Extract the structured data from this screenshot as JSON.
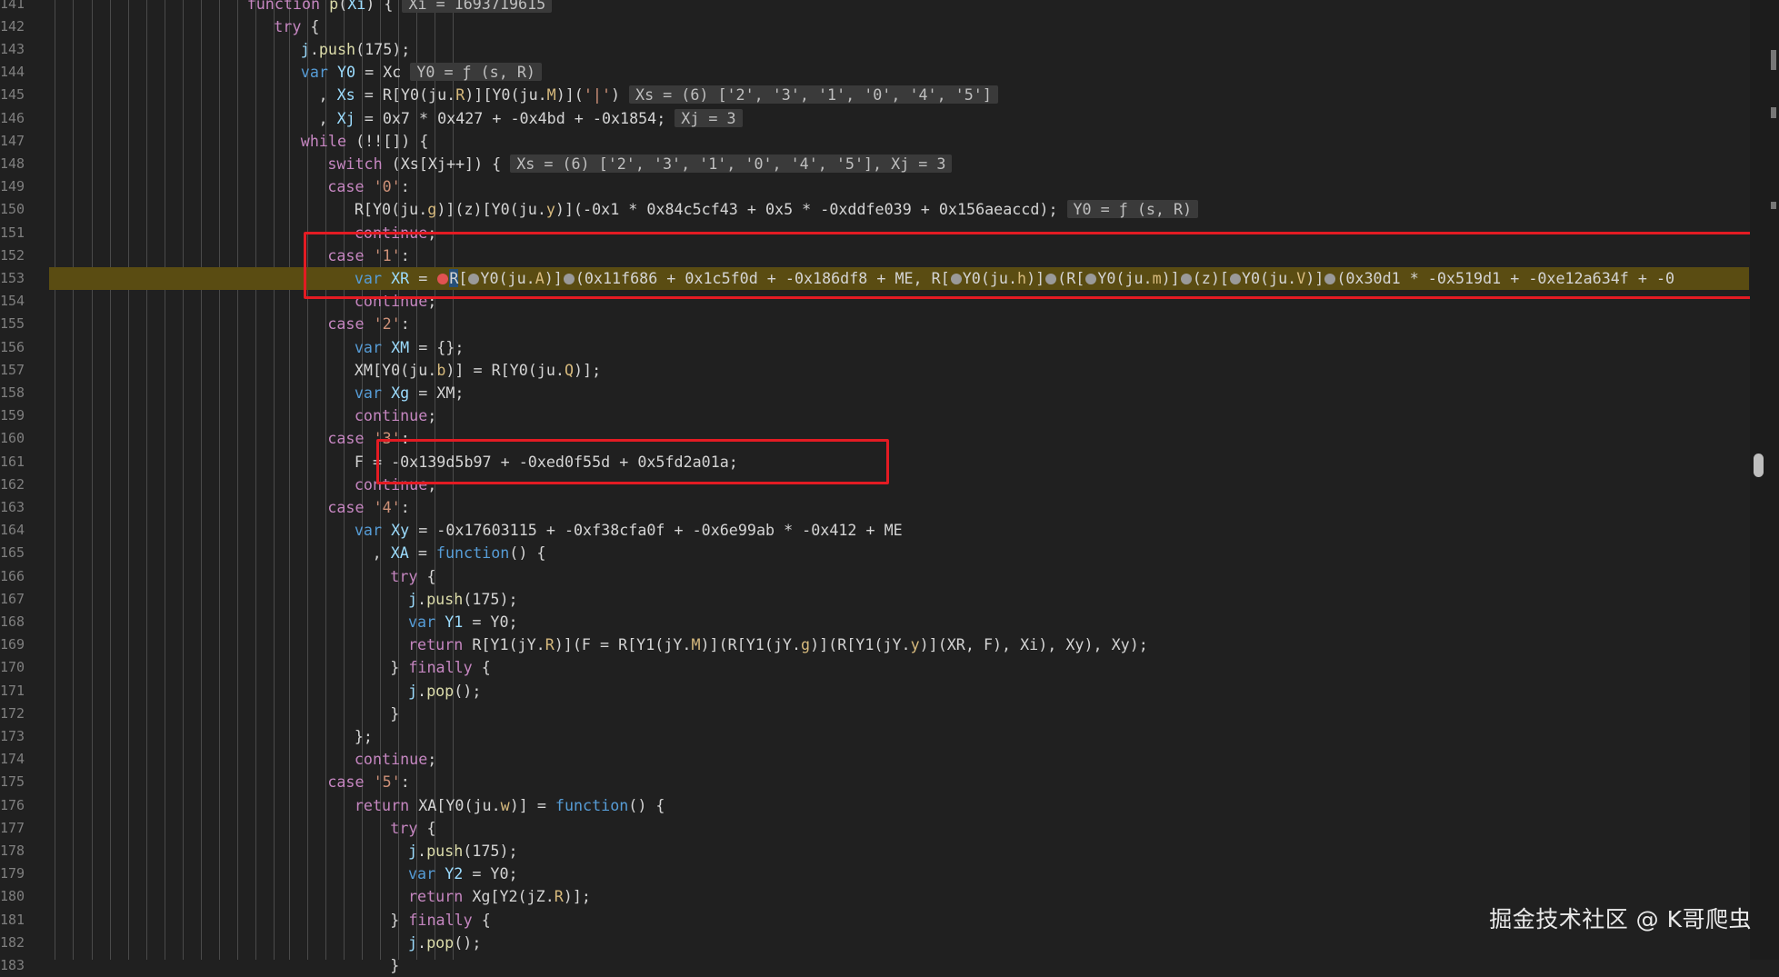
{
  "editor": {
    "lines": [
      {
        "n": "141",
        "parts": [
          [
            "k",
            "function "
          ],
          [
            "fn",
            "p"
          ],
          [
            "c",
            "("
          ],
          [
            "v",
            "Xi"
          ],
          [
            "c",
            ") {"
          ],
          [
            "hint",
            "Xi = 1693719615"
          ]
        ]
      },
      {
        "n": "142",
        "parts": [
          [
            "k",
            "try"
          ],
          [
            "c",
            " {"
          ]
        ]
      },
      {
        "n": "143",
        "parts": [
          [
            "v",
            "j"
          ],
          [
            "c",
            "."
          ],
          [
            "fn",
            "push"
          ],
          [
            "c",
            "(175);"
          ]
        ]
      },
      {
        "n": "144",
        "parts": [
          [
            "kb",
            "var "
          ],
          [
            "v",
            "Y0"
          ],
          [
            "c",
            " = Xc"
          ],
          [
            "hint",
            "Y0 = ƒ (s, R)"
          ]
        ]
      },
      {
        "n": "145",
        "parts": [
          [
            "c",
            ", "
          ],
          [
            "v",
            "Xs"
          ],
          [
            "c",
            " = R[Y0(ju."
          ],
          [
            "p",
            "R"
          ],
          [
            "c",
            ")][Y0(ju."
          ],
          [
            "p",
            "M"
          ],
          [
            "c",
            ")]("
          ],
          [
            "s",
            "'|'"
          ],
          [
            "c",
            ")"
          ],
          [
            "hint",
            "Xs = (6) ['2', '3', '1', '0', '4', '5']"
          ]
        ]
      },
      {
        "n": "146",
        "parts": [
          [
            "c",
            ", "
          ],
          [
            "v",
            "Xj"
          ],
          [
            "c",
            " = 0x7 * 0x427 + -0x4bd + -0x1854;"
          ],
          [
            "hint",
            "Xj = 3"
          ]
        ]
      },
      {
        "n": "147",
        "parts": [
          [
            "k",
            "while"
          ],
          [
            "c",
            " (!![]) {"
          ]
        ]
      },
      {
        "n": "148",
        "parts": [
          [
            "k",
            "switch"
          ],
          [
            "c",
            " (Xs[Xj++]) {"
          ],
          [
            "hint",
            "Xs = (6) ['2', '3', '1', '0', '4', '5'], Xj = 3"
          ]
        ]
      },
      {
        "n": "149",
        "parts": [
          [
            "k",
            "case "
          ],
          [
            "s",
            "'0'"
          ],
          [
            "c",
            ":"
          ]
        ]
      },
      {
        "n": "150",
        "parts": [
          [
            "c",
            "R[Y0(ju."
          ],
          [
            "p",
            "g"
          ],
          [
            "c",
            ")](z)[Y0(ju."
          ],
          [
            "p",
            "y"
          ],
          [
            "c",
            ")](-0x1 * 0x84c5cf43 + 0x5 * -0xddfe039 + 0x156aeaccd);"
          ],
          [
            "hint",
            "Y0 = ƒ (s, R)"
          ]
        ]
      },
      {
        "n": "151",
        "parts": [
          [
            "k",
            "continue"
          ],
          [
            "c",
            ";"
          ]
        ]
      },
      {
        "n": "152",
        "parts": [
          [
            "k",
            "case "
          ],
          [
            "s",
            "'1'"
          ],
          [
            "c",
            ":"
          ]
        ]
      },
      {
        "n": "153",
        "parts": [
          [
            "kb",
            "var "
          ],
          [
            "v",
            "XR"
          ],
          [
            "c",
            " = "
          ],
          [
            "dotred",
            ""
          ],
          [
            "sel",
            "R"
          ],
          [
            "c",
            "["
          ],
          [
            "dot",
            ""
          ],
          [
            "c",
            "Y0(ju."
          ],
          [
            "p",
            "A"
          ],
          [
            "c",
            ")]"
          ],
          [
            "dot",
            ""
          ],
          [
            "c",
            "(0x11f686 + 0x1c5f0d + -0x186df8 + ME, R["
          ],
          [
            "dot",
            ""
          ],
          [
            "c",
            "Y0(ju."
          ],
          [
            "p",
            "h"
          ],
          [
            "c",
            ")]"
          ],
          [
            "dot",
            ""
          ],
          [
            "c",
            "(R["
          ],
          [
            "dot",
            ""
          ],
          [
            "c",
            "Y0(ju."
          ],
          [
            "p",
            "m"
          ],
          [
            "c",
            ")]"
          ],
          [
            "dot",
            ""
          ],
          [
            "c",
            "(z)["
          ],
          [
            "dot",
            ""
          ],
          [
            "c",
            "Y0(ju."
          ],
          [
            "p",
            "V"
          ],
          [
            "c",
            ")]"
          ],
          [
            "dot",
            ""
          ],
          [
            "c",
            "(0x30d1 * -0x519d1 + -0xe12a634f + -0"
          ]
        ]
      },
      {
        "n": "154",
        "parts": [
          [
            "k",
            "continue"
          ],
          [
            "c",
            ";"
          ]
        ]
      },
      {
        "n": "155",
        "parts": [
          [
            "k",
            "case "
          ],
          [
            "s",
            "'2'"
          ],
          [
            "c",
            ":"
          ]
        ]
      },
      {
        "n": "156",
        "parts": [
          [
            "kb",
            "var "
          ],
          [
            "v",
            "XM"
          ],
          [
            "c",
            " = {};"
          ]
        ]
      },
      {
        "n": "157",
        "parts": [
          [
            "c",
            "XM[Y0(ju."
          ],
          [
            "p",
            "b"
          ],
          [
            "c",
            ")] = R[Y0(ju."
          ],
          [
            "p",
            "Q"
          ],
          [
            "c",
            ")];"
          ]
        ]
      },
      {
        "n": "158",
        "parts": [
          [
            "kb",
            "var "
          ],
          [
            "v",
            "Xg"
          ],
          [
            "c",
            " = XM;"
          ]
        ]
      },
      {
        "n": "159",
        "parts": [
          [
            "k",
            "continue"
          ],
          [
            "c",
            ";"
          ]
        ]
      },
      {
        "n": "160",
        "parts": [
          [
            "k",
            "case "
          ],
          [
            "s",
            "'3'"
          ],
          [
            "c",
            ":"
          ]
        ]
      },
      {
        "n": "161",
        "parts": [
          [
            "c",
            "F = -0x139d5b97 + -0xed0f55d + 0x5fd2a01a;"
          ]
        ]
      },
      {
        "n": "162",
        "parts": [
          [
            "k",
            "continue"
          ],
          [
            "c",
            ";"
          ]
        ]
      },
      {
        "n": "163",
        "parts": [
          [
            "k",
            "case "
          ],
          [
            "s",
            "'4'"
          ],
          [
            "c",
            ":"
          ]
        ]
      },
      {
        "n": "164",
        "parts": [
          [
            "kb",
            "var "
          ],
          [
            "v",
            "Xy"
          ],
          [
            "c",
            " = -0x17603115 + -0xf38cfa0f + -0x6e99ab * -0x412 + ME"
          ]
        ]
      },
      {
        "n": "165",
        "parts": [
          [
            "c",
            ", "
          ],
          [
            "v",
            "XA"
          ],
          [
            "c",
            " = "
          ],
          [
            "kb",
            "function"
          ],
          [
            "c",
            "() {"
          ]
        ]
      },
      {
        "n": "166",
        "parts": [
          [
            "k",
            "try"
          ],
          [
            "c",
            " {"
          ]
        ]
      },
      {
        "n": "167",
        "parts": [
          [
            "v",
            "j"
          ],
          [
            "c",
            "."
          ],
          [
            "fn",
            "push"
          ],
          [
            "c",
            "(175);"
          ]
        ]
      },
      {
        "n": "168",
        "parts": [
          [
            "kb",
            "var "
          ],
          [
            "v",
            "Y1"
          ],
          [
            "c",
            " = Y0;"
          ]
        ]
      },
      {
        "n": "169",
        "parts": [
          [
            "k",
            "return "
          ],
          [
            "c",
            "R[Y1(jY."
          ],
          [
            "p",
            "R"
          ],
          [
            "c",
            ")](F = R[Y1(jY."
          ],
          [
            "p",
            "M"
          ],
          [
            "c",
            ")](R[Y1(jY."
          ],
          [
            "p",
            "g"
          ],
          [
            "c",
            ")](R[Y1(jY."
          ],
          [
            "p",
            "y"
          ],
          [
            "c",
            ")](XR, F), Xi), Xy), Xy);"
          ]
        ]
      },
      {
        "n": "170",
        "parts": [
          [
            "c",
            "} "
          ],
          [
            "k",
            "finally"
          ],
          [
            "c",
            " {"
          ]
        ]
      },
      {
        "n": "171",
        "parts": [
          [
            "v",
            "j"
          ],
          [
            "c",
            "."
          ],
          [
            "fn",
            "pop"
          ],
          [
            "c",
            "();"
          ]
        ]
      },
      {
        "n": "172",
        "parts": [
          [
            "c",
            "}"
          ]
        ]
      },
      {
        "n": "173",
        "parts": [
          [
            "c",
            "};"
          ]
        ]
      },
      {
        "n": "174",
        "parts": [
          [
            "k",
            "continue"
          ],
          [
            "c",
            ";"
          ]
        ]
      },
      {
        "n": "175",
        "parts": [
          [
            "k",
            "case "
          ],
          [
            "s",
            "'5'"
          ],
          [
            "c",
            ":"
          ]
        ]
      },
      {
        "n": "176",
        "parts": [
          [
            "k",
            "return "
          ],
          [
            "c",
            "XA[Y0(ju."
          ],
          [
            "p",
            "w"
          ],
          [
            "c",
            ")] = "
          ],
          [
            "kb",
            "function"
          ],
          [
            "c",
            "() {"
          ]
        ]
      },
      {
        "n": "177",
        "parts": [
          [
            "k",
            "try"
          ],
          [
            "c",
            " {"
          ]
        ]
      },
      {
        "n": "178",
        "parts": [
          [
            "v",
            "j"
          ],
          [
            "c",
            "."
          ],
          [
            "fn",
            "push"
          ],
          [
            "c",
            "(175);"
          ]
        ]
      },
      {
        "n": "179",
        "parts": [
          [
            "kb",
            "var "
          ],
          [
            "v",
            "Y2"
          ],
          [
            "c",
            " = Y0;"
          ]
        ]
      },
      {
        "n": "180",
        "parts": [
          [
            "k",
            "return "
          ],
          [
            "c",
            "Xg[Y2(jZ."
          ],
          [
            "p",
            "R"
          ],
          [
            "c",
            ")];"
          ]
        ]
      },
      {
        "n": "181",
        "parts": [
          [
            "c",
            "} "
          ],
          [
            "k",
            "finally"
          ],
          [
            "c",
            " {"
          ]
        ]
      },
      {
        "n": "182",
        "parts": [
          [
            "v",
            "j"
          ],
          [
            "c",
            "."
          ],
          [
            "fn",
            "pop"
          ],
          [
            "c",
            "();"
          ]
        ]
      },
      {
        "n": "183",
        "parts": [
          [
            "c",
            "}"
          ]
        ]
      }
    ]
  },
  "watermark": "掘金技术社区 @ K哥爬虫"
}
